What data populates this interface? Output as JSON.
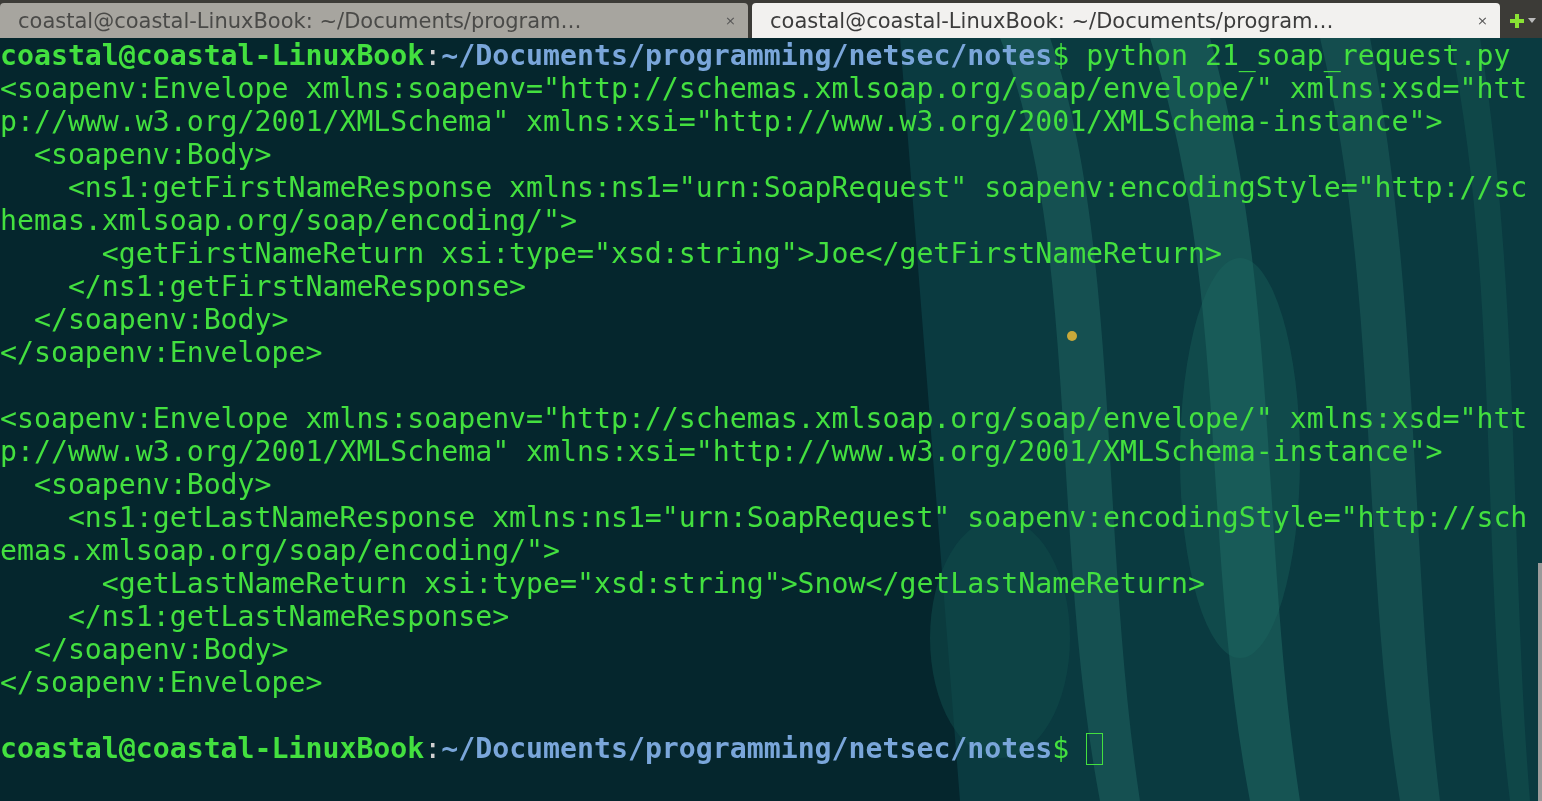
{
  "tabs": [
    {
      "title": "coastal@coastal-LinuxBook: ~/Documents/program…",
      "close": "×",
      "selected": false
    },
    {
      "title": "coastal@coastal-LinuxBook: ~/Documents/program…",
      "close": "×",
      "selected": true
    }
  ],
  "lines": [
    {
      "kind": "prompt",
      "user_host": "coastal@coastal-LinuxBook",
      "separator": ":",
      "path": "~/Documents/programming/netsec/notes",
      "symbol": "$",
      "command": " python 21_soap_request.py",
      "cursor": false
    },
    {
      "kind": "output",
      "text": "<soapenv:Envelope xmlns:soapenv=\"http://schemas.xmlsoap.org/soap/envelope/\" xmlns:xsd=\"htt"
    },
    {
      "kind": "output",
      "text": "p://www.w3.org/2001/XMLSchema\" xmlns:xsi=\"http://www.w3.org/2001/XMLSchema-instance\">"
    },
    {
      "kind": "output",
      "text": "  <soapenv:Body>"
    },
    {
      "kind": "output",
      "text": "    <ns1:getFirstNameResponse xmlns:ns1=\"urn:SoapRequest\" soapenv:encodingStyle=\"http://sc"
    },
    {
      "kind": "output",
      "text": "hemas.xmlsoap.org/soap/encoding/\">"
    },
    {
      "kind": "output",
      "text": "      <getFirstNameReturn xsi:type=\"xsd:string\">Joe</getFirstNameReturn>"
    },
    {
      "kind": "output",
      "text": "    </ns1:getFirstNameResponse>"
    },
    {
      "kind": "output",
      "text": "  </soapenv:Body>"
    },
    {
      "kind": "output",
      "text": "</soapenv:Envelope>"
    },
    {
      "kind": "blank"
    },
    {
      "kind": "output",
      "text": "<soapenv:Envelope xmlns:soapenv=\"http://schemas.xmlsoap.org/soap/envelope/\" xmlns:xsd=\"htt"
    },
    {
      "kind": "output",
      "text": "p://www.w3.org/2001/XMLSchema\" xmlns:xsi=\"http://www.w3.org/2001/XMLSchema-instance\">"
    },
    {
      "kind": "output",
      "text": "  <soapenv:Body>"
    },
    {
      "kind": "output",
      "text": "    <ns1:getLastNameResponse xmlns:ns1=\"urn:SoapRequest\" soapenv:encodingStyle=\"http://sch"
    },
    {
      "kind": "output",
      "text": "emas.xmlsoap.org/soap/encoding/\">"
    },
    {
      "kind": "output",
      "text": "      <getLastNameReturn xsi:type=\"xsd:string\">Snow</getLastNameReturn>"
    },
    {
      "kind": "output",
      "text": "    </ns1:getLastNameResponse>"
    },
    {
      "kind": "output",
      "text": "  </soapenv:Body>"
    },
    {
      "kind": "output",
      "text": "</soapenv:Envelope>"
    },
    {
      "kind": "blank"
    },
    {
      "kind": "prompt",
      "user_host": "coastal@coastal-LinuxBook",
      "separator": ":",
      "path": "~/Documents/programming/netsec/notes",
      "symbol": "$",
      "cursor": true
    }
  ]
}
